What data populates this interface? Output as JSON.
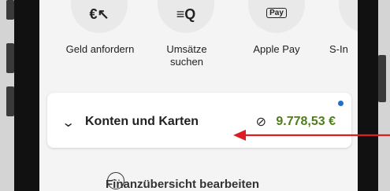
{
  "actions": [
    {
      "label": "Geld anfordern",
      "icon": "request-money-icon",
      "glyph": "€↖"
    },
    {
      "label": "Umsätze suchen",
      "icon": "search-transactions-icon",
      "glyph": "≡Q"
    },
    {
      "label": "Apple Pay",
      "icon": "apple-pay-icon",
      "glyph": "Pay"
    },
    {
      "label": "S-In",
      "icon": "partial-icon",
      "glyph": "…"
    }
  ],
  "accounts_card": {
    "title": "Konten und Karten",
    "amount": "9.778,53 €",
    "amount_color": "#4f7c1e",
    "hidden_eye_icon": "eye-slash-icon",
    "notification_dot_color": "#1f6fd1"
  },
  "edit": {
    "label": "Finanzübersicht bearbeiten"
  },
  "annotation": {
    "arrow_color": "#e11b22"
  }
}
